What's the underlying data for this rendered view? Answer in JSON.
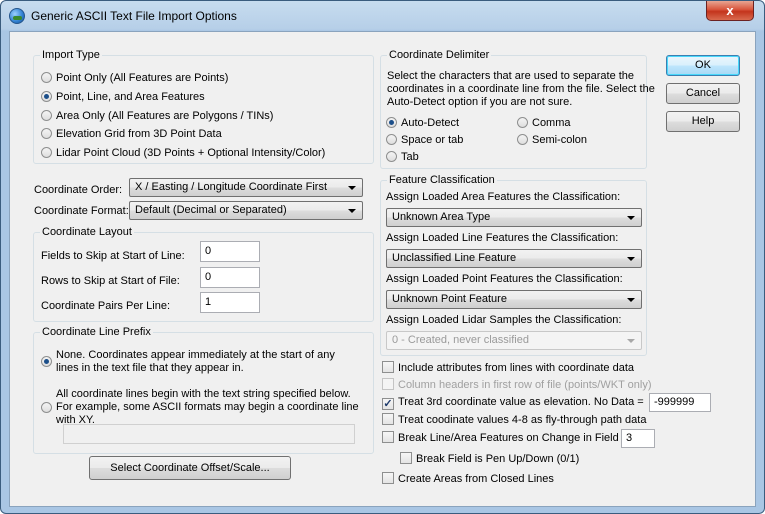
{
  "window": {
    "title": "Generic ASCII Text File Import Options",
    "close_label": "x"
  },
  "import_type": {
    "label": "Import Type",
    "options": [
      "Point Only (All Features are Points)",
      "Point, Line, and Area Features",
      "Area Only (All Features are Polygons / TINs)",
      "Elevation Grid from 3D Point Data",
      "Lidar Point Cloud (3D Points + Optional Intensity/Color)"
    ],
    "selected_index": 1
  },
  "coordinate_order": {
    "label": "Coordinate Order:",
    "value": "X / Easting / Longitude Coordinate First"
  },
  "coordinate_format": {
    "label": "Coordinate Format:",
    "value": "Default (Decimal or Separated)"
  },
  "coordinate_layout": {
    "label": "Coordinate Layout",
    "fields_skip_label": "Fields to Skip at Start of Line:",
    "fields_skip_value": "0",
    "rows_skip_label": "Rows to Skip at Start of File:",
    "rows_skip_value": "0",
    "pairs_label": "Coordinate Pairs Per Line:",
    "pairs_value": "1"
  },
  "prefix": {
    "label": "Coordinate Line Prefix",
    "option_none_lines": [
      "None. Coordinates appear immediately at the start of any",
      "lines in the text file that they appear in."
    ],
    "option_string_lines": [
      "All coordinate lines begin with the text string specified below.",
      "For example, some ASCII formats may begin a coordinate line",
      "with XY."
    ],
    "prefix_value": ""
  },
  "offset_button": "Select Coordinate Offset/Scale...",
  "delimiter": {
    "label": "Coordinate Delimiter",
    "description_lines": [
      "Select the characters that are used to separate the",
      "coordinates in a coordinate line from the file. Select the",
      "Auto-Detect option if you are not sure."
    ],
    "auto_detect": "Auto-Detect",
    "comma": "Comma",
    "space_tab": "Space or tab",
    "semicolon": "Semi-colon",
    "tab": "Tab"
  },
  "classification": {
    "label": "Feature Classification",
    "area_label": "Assign Loaded Area Features the Classification:",
    "area_value": "Unknown Area Type",
    "line_label": "Assign Loaded Line Features the Classification:",
    "line_value": "Unclassified Line Feature",
    "point_label": "Assign Loaded Point Features the Classification:",
    "point_value": "Unknown Point Feature",
    "lidar_label": "Assign Loaded Lidar Samples the Classification:",
    "lidar_value": "0 - Created, never classified"
  },
  "options": {
    "include_attrs": "Include attributes from lines with coordinate data",
    "column_headers": "Column headers in first row of file (points/WKT only)",
    "treat_3rd": "Treat 3rd coordinate value as elevation. No Data =",
    "no_data_value": "-999999",
    "fly_through": "Treat coodinate values 4-8 as fly-through path data",
    "break_line": "Break Line/Area Features on Change in Field",
    "break_field_value": "3",
    "pen_up_down": "Break Field is Pen Up/Down (0/1)",
    "create_areas": "Create Areas from Closed Lines"
  },
  "buttons": {
    "ok": "OK",
    "cancel": "Cancel",
    "help": "Help"
  }
}
